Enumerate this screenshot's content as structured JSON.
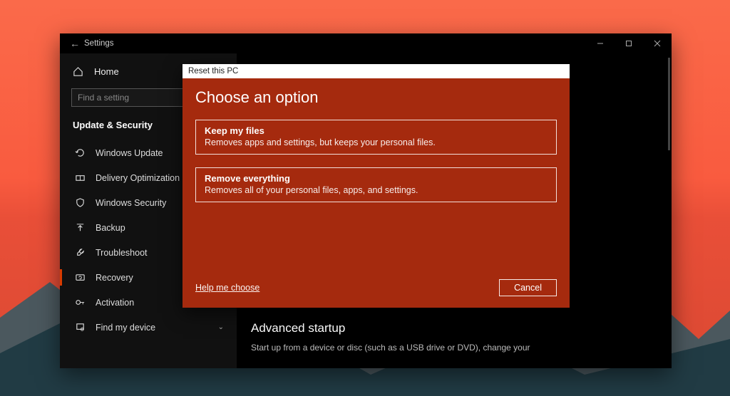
{
  "window": {
    "title": "Settings",
    "controls": {
      "minimize": "min",
      "maximize": "max",
      "close": "close"
    }
  },
  "sidebar": {
    "home_label": "Home",
    "search_placeholder": "Find a setting",
    "section_title": "Update & Security",
    "items": [
      {
        "icon": "refresh-icon",
        "label": "Windows Update"
      },
      {
        "icon": "delivery-icon",
        "label": "Delivery Optimization"
      },
      {
        "icon": "shield-icon",
        "label": "Windows Security"
      },
      {
        "icon": "backup-icon",
        "label": "Backup"
      },
      {
        "icon": "wrench-icon",
        "label": "Troubleshoot"
      },
      {
        "icon": "recovery-icon",
        "label": "Recovery",
        "selected": true
      },
      {
        "icon": "key-icon",
        "label": "Activation"
      },
      {
        "icon": "find-device-icon",
        "label": "Find my device",
        "chevron": true
      }
    ]
  },
  "content": {
    "advanced_heading": "Advanced startup",
    "advanced_body": "Start up from a device or disc (such as a USB drive or DVD), change your"
  },
  "dialog": {
    "titlebar": "Reset this PC",
    "heading": "Choose an option",
    "options": [
      {
        "title": "Keep my files",
        "desc": "Removes apps and settings, but keeps your personal files."
      },
      {
        "title": "Remove everything",
        "desc": "Removes all of your personal files, apps, and settings."
      }
    ],
    "help_link": "Help me choose",
    "cancel_label": "Cancel"
  },
  "colors": {
    "accent": "#a52a0e"
  }
}
